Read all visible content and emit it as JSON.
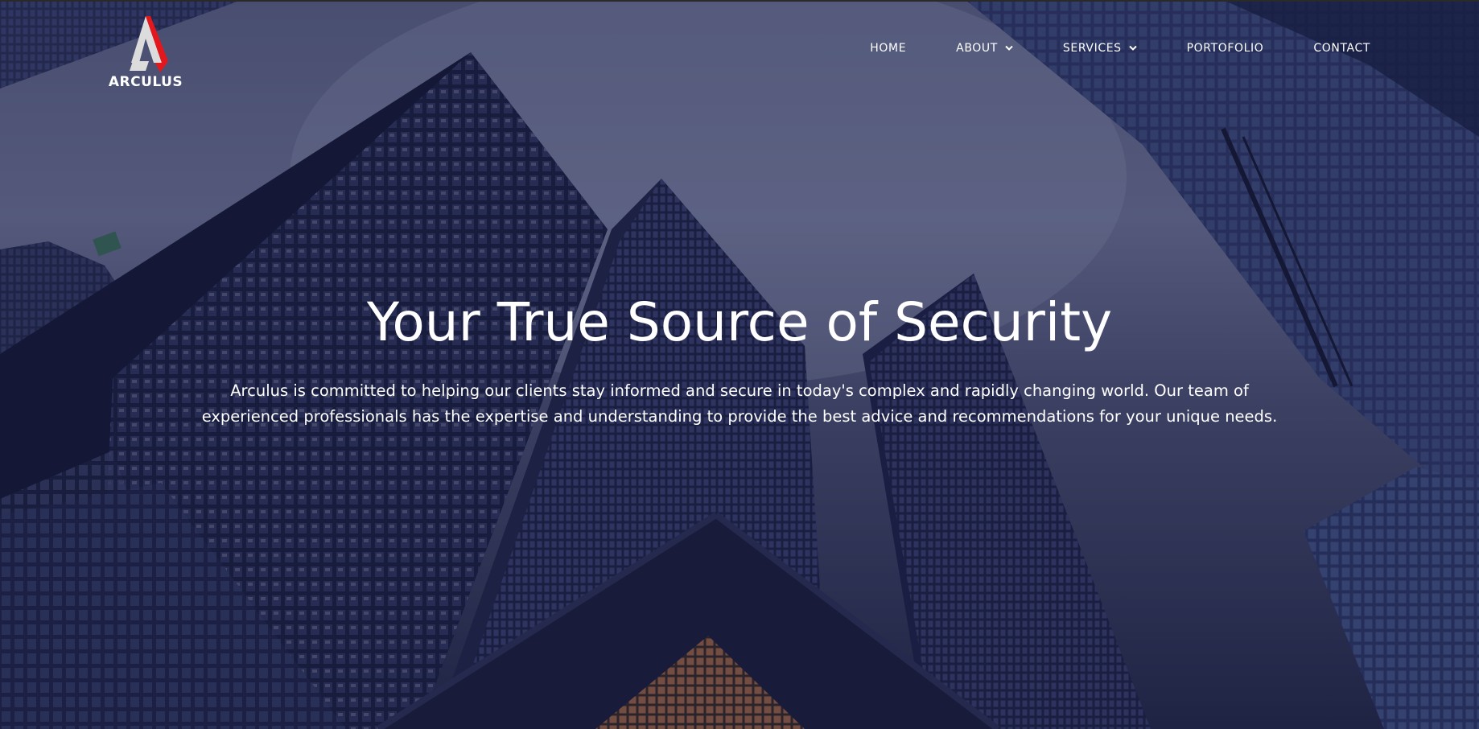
{
  "brand": {
    "name": "ARCULUS",
    "accent_color": "#e3181d",
    "logo_icon": "arculus-a-logo-icon"
  },
  "nav": {
    "items": [
      {
        "label": "HOME",
        "dropdown": false
      },
      {
        "label": "ABOUT",
        "dropdown": true
      },
      {
        "label": "SERVICES",
        "dropdown": true
      },
      {
        "label": "PORTOFOLIO",
        "dropdown": false
      },
      {
        "label": "CONTACT",
        "dropdown": false
      }
    ],
    "dropdown_icon": "chevron-down-icon"
  },
  "hero": {
    "title": "Your True Source of Security",
    "description": "Arculus is committed to helping our clients stay informed and secure in today's complex and rapidly changing world. Our team of experienced professionals has the expertise and understanding to provide the best advice and recommendations for your unique needs.",
    "background": "skyscrapers-photo"
  }
}
